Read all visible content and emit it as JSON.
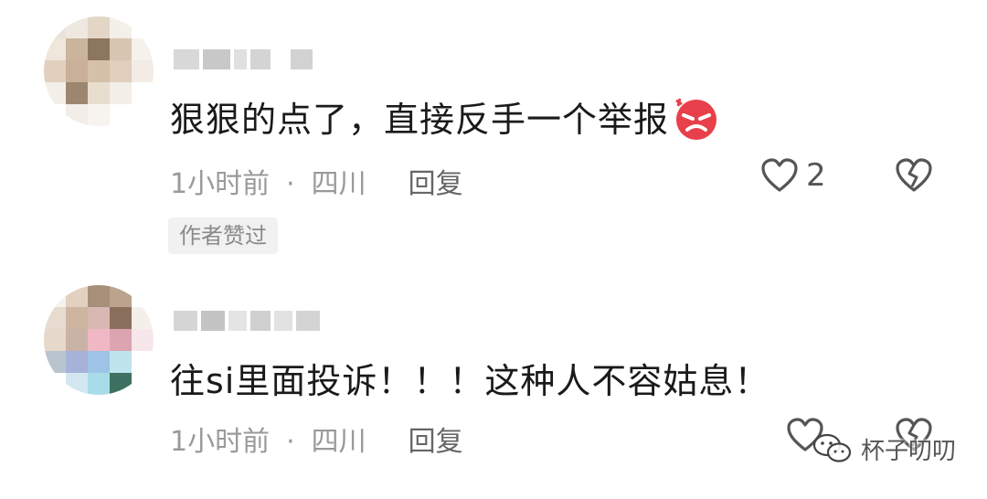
{
  "comments": [
    {
      "text": "狠狠的点了，直接反手一个举报",
      "emoji": "angry-face-icon",
      "time": "1小时前",
      "separator": "·",
      "location": "四川",
      "reply_label": "回复",
      "like_count": "2",
      "badge": "作者赞过"
    },
    {
      "text": "往si里面投诉！！！这种人不容姑息！",
      "time": "1小时前",
      "separator": "·",
      "location": "四川",
      "reply_label": "回复"
    }
  ],
  "watermark": {
    "text": "杯子叨叨",
    "icon": "wechat-icon"
  },
  "colors": {
    "text": "#1a1a1a",
    "meta": "#9a9a9a",
    "badge_bg": "#f1f1f1",
    "emoji": "#e8404a"
  }
}
